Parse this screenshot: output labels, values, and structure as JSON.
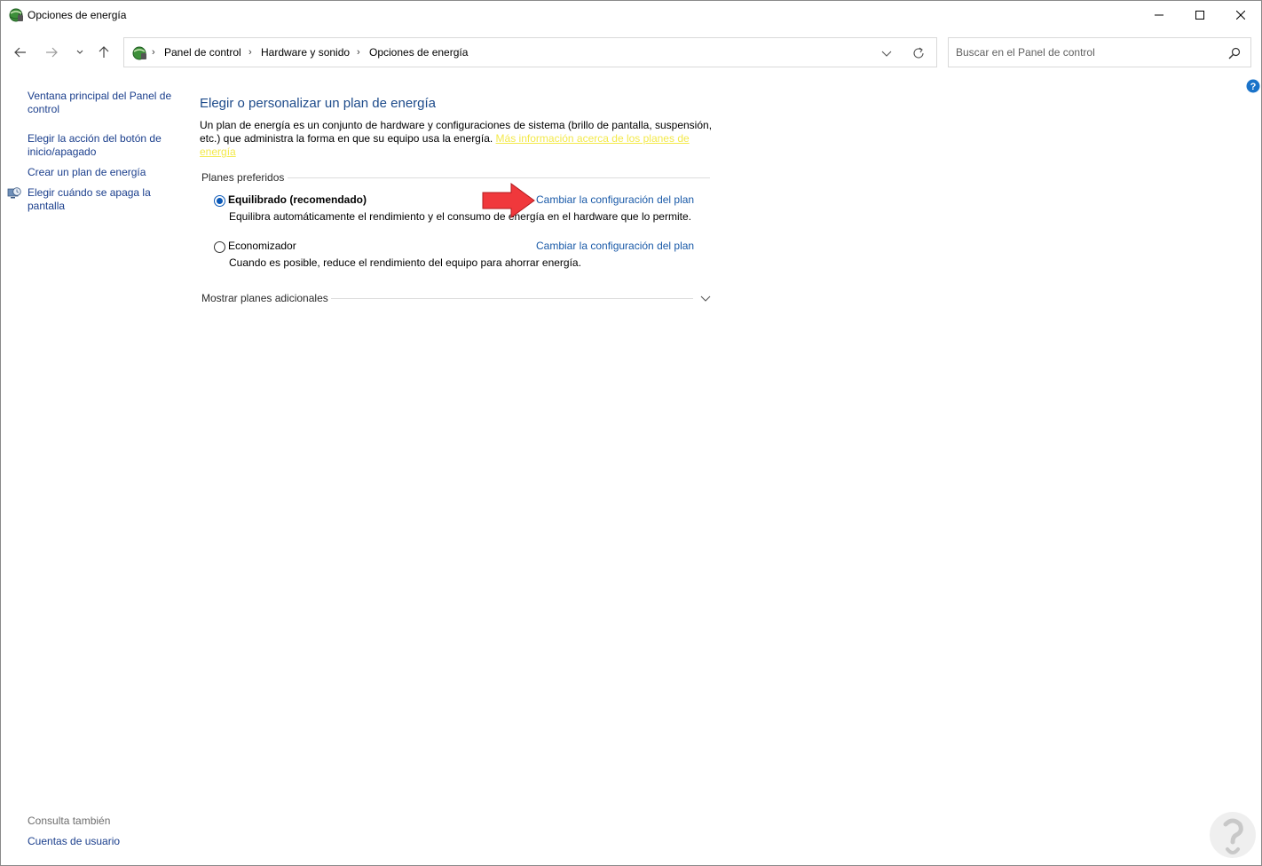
{
  "window": {
    "title": "Opciones de energía"
  },
  "address_bar": {
    "breadcrumbs": [
      "Panel de control",
      "Hardware y sonido",
      "Opciones de energía"
    ]
  },
  "search": {
    "placeholder": "Buscar en el Panel de control"
  },
  "sidebar": {
    "links": [
      "Ventana principal del Panel de control",
      "Elegir la acción del botón de inicio/apagado",
      "Crear un plan de energía",
      "Elegir cuándo se apaga la pantalla"
    ],
    "see_also_label": "Consulta también",
    "see_also_links": [
      "Cuentas de usuario"
    ]
  },
  "main": {
    "title": "Elegir o personalizar un plan de energía",
    "intro_text": "Un plan de energía es un conjunto de hardware y configuraciones de sistema (brillo de pantalla, suspensión, etc.) que administra la forma en que su equipo usa la energía. ",
    "intro_link": "Más información acerca de los planes de energía",
    "preferred_label": "Planes preferidos",
    "plans": [
      {
        "name": "Equilibrado (recomendado)",
        "description": "Equilibra automáticamente el rendimiento y el consumo de energía en el hardware que lo permite.",
        "link": "Cambiar la configuración del plan",
        "selected": true
      },
      {
        "name": "Economizador",
        "description": "Cuando es posible, reduce el rendimiento del equipo para ahorrar energía.",
        "link": "Cambiar la configuración del plan",
        "selected": false
      }
    ],
    "more_plans_label": "Mostrar planes adicionales"
  },
  "colors": {
    "link": "#1a3e8c",
    "title": "#1c4a8a",
    "annotation_arrow": "#f0383c",
    "highlight_link": "#f3e94a",
    "radio_selected": "#0a58b7"
  },
  "icons": {
    "app": "power-options-icon",
    "back": "arrow-left-icon",
    "forward": "arrow-right-icon",
    "recent": "chevron-down-icon",
    "up": "arrow-up-icon",
    "refresh": "refresh-icon",
    "search": "search-icon",
    "help": "help-icon"
  }
}
